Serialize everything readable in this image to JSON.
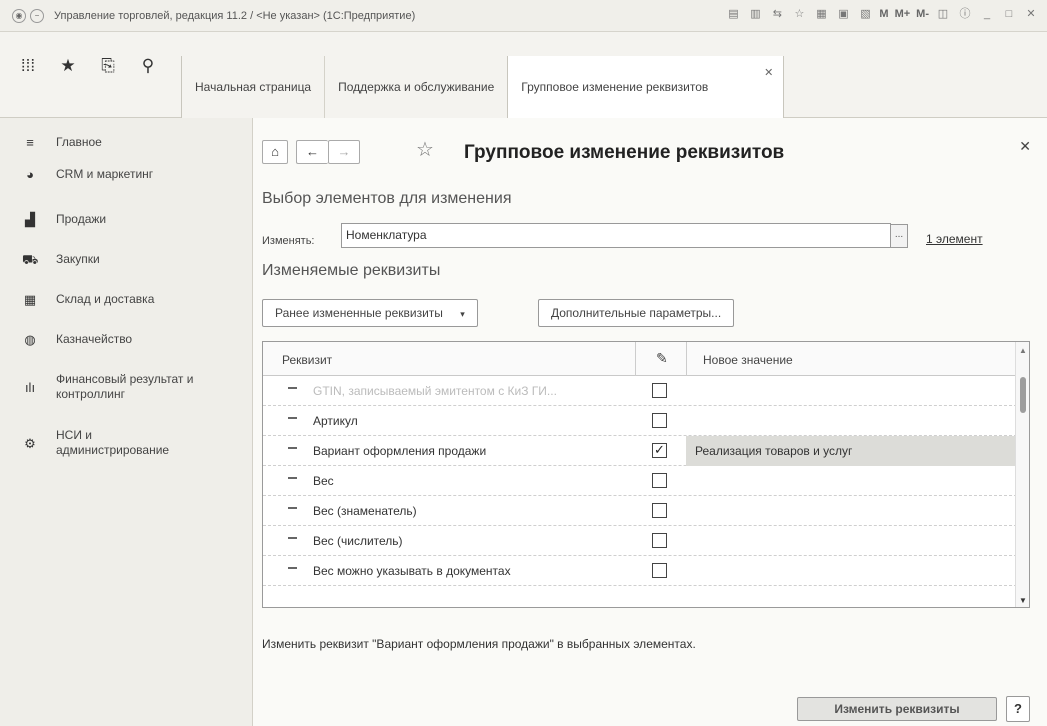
{
  "window": {
    "title": "Управление торговлей, редакция 11.2 / <Не указан> (1С:Предприятие)",
    "right_labels": [
      "M",
      "M+",
      "M-"
    ]
  },
  "nav": {
    "tabs": [
      {
        "label": "Начальная страница"
      },
      {
        "label": "Поддержка и обслуживание"
      },
      {
        "label": "Групповое изменение реквизитов"
      }
    ]
  },
  "sidebar": {
    "items": [
      {
        "label": "Главное",
        "icon": "menu-icon"
      },
      {
        "label": "CRM и маркетинг",
        "icon": "crm-icon"
      },
      {
        "label": "Продажи",
        "icon": "sales-icon"
      },
      {
        "label": "Закупки",
        "icon": "cart-icon"
      },
      {
        "label": "Склад и доставка",
        "icon": "warehouse-icon"
      },
      {
        "label": "Казначейство",
        "icon": "treasury-icon"
      },
      {
        "label": "Финансовый результат и контроллинг",
        "icon": "chart-icon"
      },
      {
        "label": "НСИ и администрирование",
        "icon": "gear-icon"
      }
    ]
  },
  "form": {
    "title": "Групповое изменение реквизитов",
    "section_select": "Выбор элементов для изменения",
    "change_label": "Изменять:",
    "change_value": "Номенклатура",
    "elements_link": "1 элемент",
    "section_attrs": "Изменяемые реквизиты",
    "btn_prev": "Ранее измененные реквизиты",
    "btn_more": "Дополнительные параметры...",
    "table": {
      "col_attr": "Реквизит",
      "col_new": "Новое значение",
      "rows": [
        {
          "name": "GTIN, записываемый эмитентом с КиЗ ГИ...",
          "checked": false,
          "value": ""
        },
        {
          "name": "Артикул",
          "checked": false,
          "value": ""
        },
        {
          "name": "Вариант оформления продажи",
          "checked": true,
          "value": "Реализация товаров и услуг"
        },
        {
          "name": "Вес",
          "checked": false,
          "value": ""
        },
        {
          "name": "Вес (знаменатель)",
          "checked": false,
          "value": ""
        },
        {
          "name": "Вес (числитель)",
          "checked": false,
          "value": ""
        },
        {
          "name": "Вес можно указывать в документах",
          "checked": false,
          "value": ""
        }
      ]
    },
    "hint": "Изменить реквизит \"Вариант оформления продажи\" в выбранных элементах.",
    "apply_button": "Изменить реквизиты",
    "help_button": "?"
  }
}
